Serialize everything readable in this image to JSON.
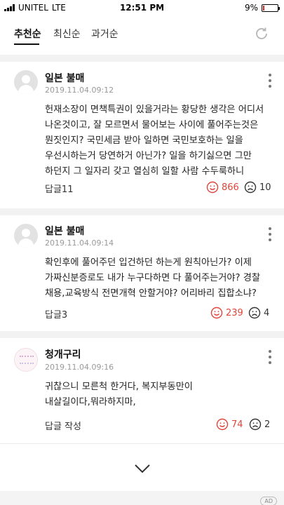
{
  "status_bar": {
    "carrier": "UNITEL",
    "network": "LTE",
    "time": "12:51 PM",
    "battery_text": "9%",
    "battery_level": 0.09
  },
  "tabs": [
    {
      "label": "추천순",
      "active": true
    },
    {
      "label": "최신순",
      "active": false
    },
    {
      "label": "과거순",
      "active": false
    }
  ],
  "comments": [
    {
      "name": "일본 불매",
      "date": "2019.11.04.09:12",
      "text": "헌재소장이 면책특권이 있을거라는 황당한 생각은 어디서 나온것이고, 잘 모르면서 물어보는 사이에 풀어주는것은 뭔짓인지? 국민세금 받아 일하면 국민보호하는 일을 우선시하는거 당연하거 아닌가? 일을 하기싫으면 그만 하던지 그 일자리 갖고 열심히 일할 사람 수두룩하니",
      "reply": "답글11",
      "likes": "866",
      "dislikes": "10"
    },
    {
      "name": "일본 불매",
      "date": "2019.11.04.09:14",
      "text": "확인후에 풀어주던 입건하던 하는게 원칙아닌가? 이제 가짜신분증로도 내가 누구다하면 다 풀어주는거야? 경찰 채용,교육방식 전면개혁 안할거야? 어리바리 집합소냐?",
      "reply": "답글3",
      "likes": "239",
      "dislikes": "4"
    },
    {
      "name": "청개구리",
      "date": "2019.11.04.09:16",
      "text": "귀찮으니 모른척 한거다, 복지부동만이 내살길이다,뭐라하지마,",
      "reply": "답글 작성",
      "likes": "74",
      "dislikes": "2"
    }
  ],
  "ad_label": "AD",
  "colors": {
    "like": "#e0443a",
    "accent_text": "#111111",
    "divider": "#f2f2f2"
  }
}
